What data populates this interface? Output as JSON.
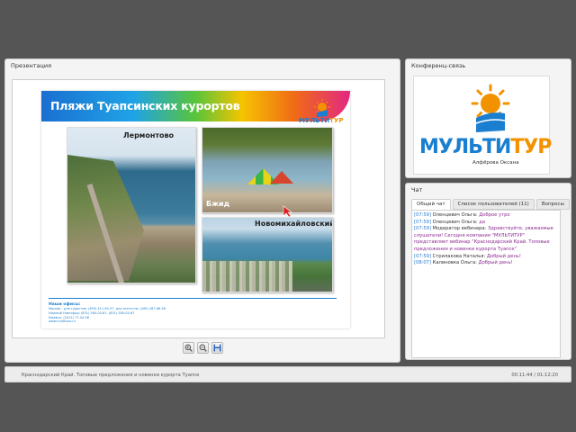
{
  "presentation": {
    "title": "Презентация",
    "slide": {
      "title": "Пляжи Туапсинских курортов",
      "logo_text_a": "МУЛЬТИ",
      "logo_text_b": "ТУР",
      "photos": [
        {
          "label": "Лермонтово"
        },
        {
          "label": "Бжид"
        },
        {
          "label": "Новомихайловский"
        }
      ],
      "offices_title": "Наши офисы:",
      "offices_lines": [
        "Москва - для туристов: (495) 411-90-37, для агентств: (495) 287-66-56",
        "Нижний Новгород: (831) 260-00-87, (831) 280-05-67",
        "Ижевск: (3412) 77-04-56",
        "www.multitour.ru"
      ]
    },
    "toolbar": [
      {
        "name": "zoom-in-button",
        "icon": "zoom-in-icon"
      },
      {
        "name": "zoom-out-button",
        "icon": "zoom-out-icon"
      },
      {
        "name": "save-button",
        "icon": "save-icon"
      }
    ]
  },
  "conference": {
    "title": "Конференц-связь",
    "logo_text_a": "МУЛЬТИ",
    "logo_text_b": "ТУР",
    "presenter_name": "Алфёрова Оксана"
  },
  "chat": {
    "title": "Чат",
    "tabs": [
      "Общий чат",
      "Список пользователей (11)",
      "Вопросы"
    ],
    "messages": [
      {
        "time": "[07:59]",
        "author": "Оленцевич Ольга:",
        "text": "Доброе утро"
      },
      {
        "time": "[07:59]",
        "author": "Оленцевич Ольга:",
        "text": "да"
      },
      {
        "time": "[07:59]",
        "author": "Модератор вебинара:",
        "text": "Здравствуйте, уважаемые слушатели! Сегодня компания \"МУЛЬТИТУР\" представляет вебинар \"Краснодарский Край. Топовые предложения и новинки курорта Туапсе\""
      },
      {
        "time": "[07:59]",
        "author": "Стрилакова Наталья:",
        "text": "Добрый день!"
      },
      {
        "time": "[08:07]",
        "author": "Калиновка Ольга:",
        "text": "Добрый день!"
      }
    ]
  },
  "status": {
    "title": "Краснодарский Край. Топовые предложения и новинки курорта Туапсе",
    "time": "00:11:44 / 01:12:20"
  },
  "colors": {
    "brand_blue": "#1a7fd0",
    "brand_orange": "#f39200",
    "chat_time": "#2a7bd1",
    "chat_text": "#8e2b93"
  }
}
